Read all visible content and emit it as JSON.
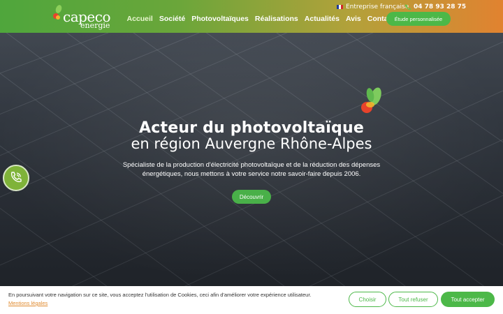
{
  "header": {
    "logo": {
      "name": "capeco",
      "sub": "energie"
    },
    "topbar": {
      "country_label": "Entreprise française",
      "phone": "04 78 93 28 75"
    },
    "nav": [
      {
        "label": "Accueil",
        "active": true
      },
      {
        "label": "Société"
      },
      {
        "label": "Photovoltaïques"
      },
      {
        "label": "Réalisations"
      },
      {
        "label": "Actualités"
      },
      {
        "label": "Avis"
      },
      {
        "label": "Contact"
      }
    ],
    "cta_label": "Étude personnalisée"
  },
  "hero": {
    "title": "Acteur du photovoltaïque",
    "subtitle": "en région Auvergne Rhône-Alpes",
    "description": "Spécialiste de la production d'électricité photovoltaïque et de la réduction des dépenses énergétiques, nous mettons à votre service notre savoir-faire depuis 2006.",
    "cta_label": "Découvrir"
  },
  "cookie": {
    "text": "En poursuivant votre navigation sur ce site, vous acceptez l'utilisation de Cookies, ceci afin d'améliorer votre expérience utilisateur.",
    "link_label": "Mentions légales",
    "buttons": {
      "choose": "Choisir",
      "refuse": "Tout refuser",
      "accept": "Tout accepter"
    }
  },
  "colors": {
    "brand_green": "#4cb848",
    "brand_orange": "#e18230",
    "link_orange": "#e08a2e"
  },
  "icons": [
    "france-flag-icon",
    "phone-icon",
    "logo-leaf-icon",
    "hero-leaf-icon",
    "call-button-icon"
  ]
}
